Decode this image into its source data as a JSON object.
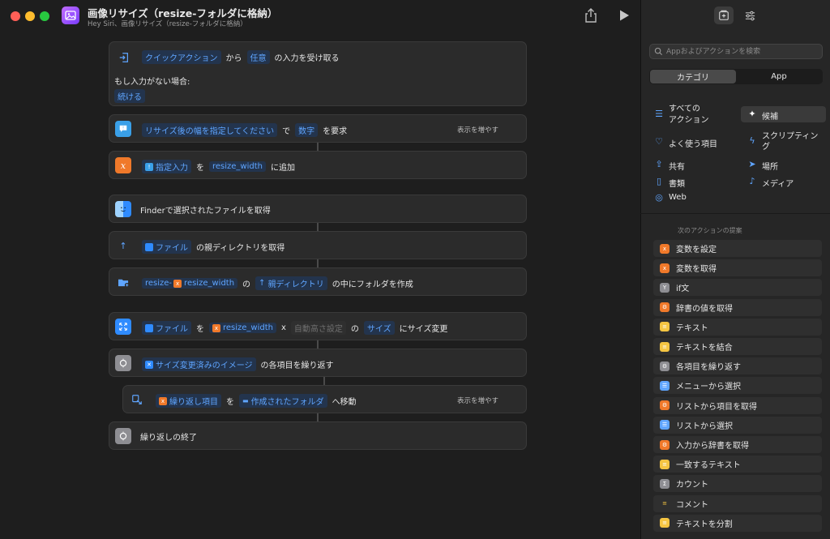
{
  "window": {
    "title": "画像リサイズ（resize-フォルダに格納）",
    "subtitle": "Hey Siri、画像リサイズ（resize-フォルダに格納）"
  },
  "actions": {
    "receive": {
      "source": "クイックアクション",
      "from": "から",
      "type": "任意",
      "suffix": "の入力を受け取る",
      "if_none_label": "もし入力がない場合:",
      "if_none_value": "続ける"
    },
    "ask": {
      "prompt": "リサイズ後の幅を指定してください",
      "de": "で",
      "kind": "数字",
      "suffix": "を要求",
      "more": "表示を増やす"
    },
    "append": {
      "token": "指定入力",
      "wo": "を",
      "var": "resize_width",
      "suffix": "に追加"
    },
    "finder": {
      "text": "Finderで選択されたファイルを取得"
    },
    "parent": {
      "token": "ファイル",
      "suffix": "の親ディレクトリを取得"
    },
    "mkdir": {
      "prefix_token": "resize-",
      "var": "resize_width",
      "no": "の",
      "dir_token": "親ディレクトリ",
      "suffix": "の中にフォルダを作成"
    },
    "resize": {
      "token": "ファイル",
      "wo": "を",
      "var": "resize_width",
      "x": "x",
      "auto": "自動高さ設定",
      "no": "の",
      "size": "サイズ",
      "suffix": "にサイズ変更"
    },
    "repeat": {
      "token": "サイズ変更済みのイメージ",
      "suffix": "の各項目を繰り返す"
    },
    "move": {
      "token": "繰り返し項目",
      "wo": "を",
      "dest": "作成されたフォルダ",
      "suffix": "へ移動",
      "more": "表示を増やす"
    },
    "end_repeat": {
      "text": "繰り返しの終了"
    }
  },
  "sidebar": {
    "search_placeholder": "Appおよびアクションを検索",
    "segments": [
      "カテゴリ",
      "App"
    ],
    "categories": {
      "all": "すべての\nアクション",
      "all_l1": "すべての",
      "all_l2": "アクション",
      "candidates": "候補",
      "favorites": "よく使う項目",
      "scripting_l1": "スクリプティン",
      "scripting_l2": "グ",
      "sharing": "共有",
      "location": "場所",
      "documents": "書類",
      "media": "メディア",
      "web": "Web"
    },
    "suggestions_header": "次のアクションの提案",
    "suggestions": [
      {
        "label": "変数を設定",
        "color": "#f0792a",
        "glyph": "x"
      },
      {
        "label": "変数を取得",
        "color": "#f0792a",
        "glyph": "x"
      },
      {
        "label": "if文",
        "color": "#8e8e93",
        "glyph": "Y"
      },
      {
        "label": "辞書の値を取得",
        "color": "#f0792a",
        "glyph": "⚙"
      },
      {
        "label": "テキスト",
        "color": "#f5c542",
        "glyph": "≡"
      },
      {
        "label": "テキストを結合",
        "color": "#f5c542",
        "glyph": "≡"
      },
      {
        "label": "各項目を繰り返す",
        "color": "#8e8e93",
        "glyph": "⚙"
      },
      {
        "label": "メニューから選択",
        "color": "#5fa5ff",
        "glyph": "☰"
      },
      {
        "label": "リストから項目を取得",
        "color": "#f0792a",
        "glyph": "⚙"
      },
      {
        "label": "リストから選択",
        "color": "#5fa5ff",
        "glyph": "☰"
      },
      {
        "label": "入力から辞書を取得",
        "color": "#f0792a",
        "glyph": "⚙"
      },
      {
        "label": "一致するテキスト",
        "color": "#f5c542",
        "glyph": "≡"
      },
      {
        "label": "カウント",
        "color": "#8e8e93",
        "glyph": "Σ"
      },
      {
        "label": "コメント",
        "color": "transparent",
        "glyph": "≡"
      },
      {
        "label": "テキストを分割",
        "color": "#f5c542",
        "glyph": "≡"
      }
    ]
  }
}
